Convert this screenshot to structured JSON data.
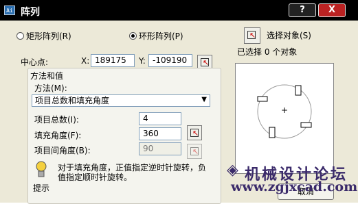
{
  "window": {
    "title": "阵列",
    "icon_text": "Ai"
  },
  "titlebar_buttons": {
    "help": "?",
    "close": "X"
  },
  "mode": {
    "rect_label": "矩形阵列(R)",
    "polar_label": "环形阵列(P)"
  },
  "select_objects": {
    "button_label": "选择对象(S)",
    "status": "已选择 0 个对象"
  },
  "center": {
    "label": "中心点:",
    "x_label": "X:",
    "x_value": "189175",
    "y_label": "Y:",
    "y_value": "-109190"
  },
  "method": {
    "group_title": "方法和值",
    "label": "方法(M):",
    "selected": "项目总数和填充角度",
    "total_label": "项目总数(I):",
    "total_value": "4",
    "fill_label": "填充角度(F):",
    "fill_value": "360",
    "between_label": "项目间角度(B):",
    "between_value": "90"
  },
  "tip": {
    "text_line1": "对于填充角度，正值指定逆时针旋转，负",
    "text_line2": "值指定顺时针旋转。",
    "label": "提示"
  },
  "preview_center_mark": "+",
  "buttons": {
    "cancel_label": "取消"
  },
  "watermark": {
    "logo": "◈",
    "cn_text": "机械设计论坛",
    "url": "www.zgjxcad.com",
    "color": "#3a2a6a"
  }
}
